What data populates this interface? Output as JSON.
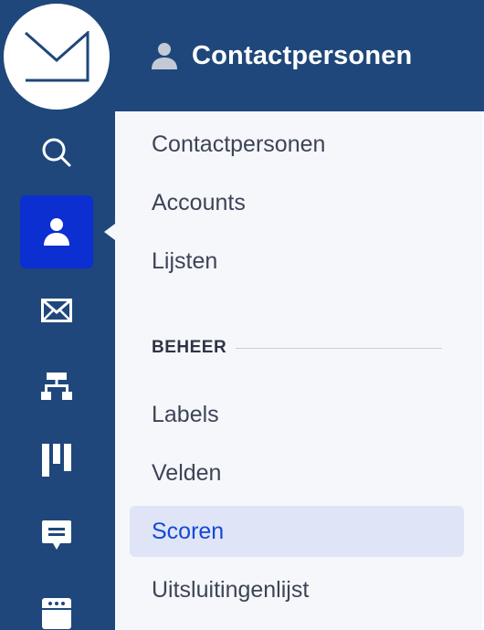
{
  "header": {
    "title": "Contactpersonen",
    "icon": "person-icon"
  },
  "rail": {
    "items": [
      {
        "name": "search",
        "icon": "search-icon"
      },
      {
        "name": "contacts",
        "icon": "person-icon",
        "active": true
      },
      {
        "name": "campaigns",
        "icon": "envelope-icon"
      },
      {
        "name": "automations",
        "icon": "sitemap-icon"
      },
      {
        "name": "deals",
        "icon": "pipeline-icon"
      },
      {
        "name": "conversations",
        "icon": "chat-icon"
      },
      {
        "name": "website",
        "icon": "browser-icon"
      }
    ]
  },
  "nav": {
    "items": [
      {
        "label": "Contactpersonen"
      },
      {
        "label": "Accounts"
      },
      {
        "label": "Lijsten"
      }
    ],
    "section_title": "BEHEER",
    "section_items": [
      {
        "label": "Labels"
      },
      {
        "label": "Velden"
      },
      {
        "label": "Scoren",
        "active": true
      },
      {
        "label": "Uitsluitingenlijst"
      }
    ]
  },
  "colors": {
    "rail_bg": "#1f477b",
    "active_rail": "#0b2fd1",
    "active_text": "#1548d6",
    "active_bg": "#dfe5f7"
  }
}
